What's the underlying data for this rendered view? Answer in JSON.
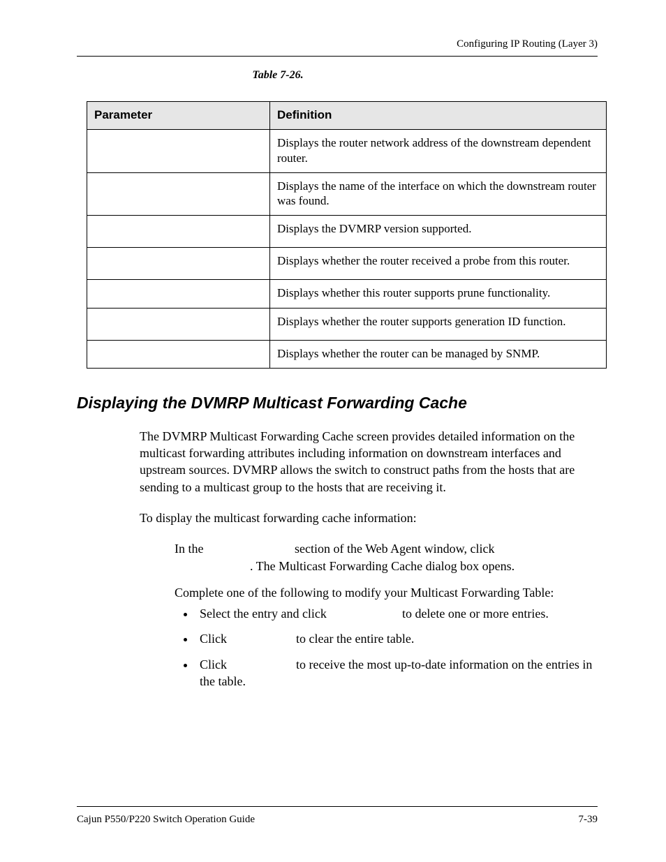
{
  "header": {
    "running": "Configuring IP Routing (Layer 3)"
  },
  "table": {
    "caption": "Table 7-26.",
    "head": {
      "c1": "Parameter",
      "c2": "Definition"
    },
    "rows": [
      {
        "p": "",
        "d": "Displays the router network address of the downstream dependent router."
      },
      {
        "p": "",
        "d": "Displays the name of the interface on which the downstream router was found."
      },
      {
        "p": "",
        "d": "Displays the DVMRP version supported."
      },
      {
        "p": "",
        "d": "Displays whether the router received a probe from this router."
      },
      {
        "p": "",
        "d": "Displays whether this router supports prune functionality."
      },
      {
        "p": "",
        "d": "Displays whether the router supports generation ID function."
      },
      {
        "p": "",
        "d": "Displays whether the router can be managed by SNMP."
      }
    ]
  },
  "section": {
    "title": "Displaying the DVMRP Multicast Forwarding Cache",
    "p1": "The DVMRP Multicast Forwarding Cache screen provides detailed information on the multicast forwarding attributes including information on downstream interfaces and upstream sources. DVMRP allows the switch to construct paths from the hosts that are sending to a multicast group to the hosts that are receiving it.",
    "p2": "To display the multicast forwarding cache information:",
    "step1a": "In the ",
    "step1b": " section of the Web Agent window, click ",
    "step1c": ". The Multicast Forwarding Cache dialog box opens.",
    "step2": "Complete one of the following to modify your Multicast Forwarding Table:",
    "b1a": "Select the entry and click ",
    "b1b": " to delete one or more entries.",
    "b2a": "Click ",
    "b2b": " to clear the entire table.",
    "b3a": "Click ",
    "b3b": " to receive the most up-to-date information on the entries in the table."
  },
  "footer": {
    "left": "Cajun P550/P220 Switch Operation Guide",
    "right": "7-39"
  }
}
